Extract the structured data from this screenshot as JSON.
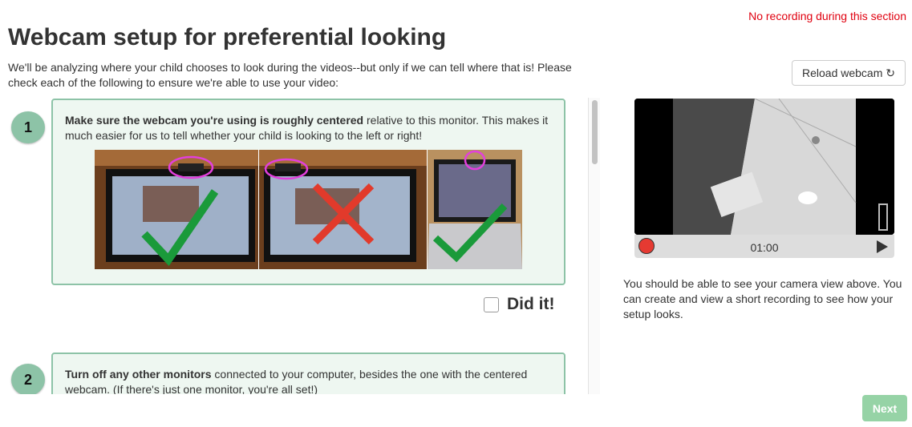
{
  "notice": "No recording during this section",
  "title": "Webcam setup for preferential looking",
  "intro": "We'll be analyzing where your child chooses to look during the videos--but only if we can tell where that is! Please check each of the following to ensure we're able to use your video:",
  "reload_label": "Reload webcam",
  "steps": [
    {
      "number": "1",
      "bold": "Make sure the webcam you're using is roughly centered",
      "text": " relative to this monitor. This makes it much easier for us to tell whether your child is looking to the left or right!",
      "done_label": "Did it!"
    },
    {
      "number": "2",
      "bold": "Turn off any other monitors",
      "text": " connected to your computer, besides the one with the centered webcam. (If there's just one monitor, you're all set!)"
    }
  ],
  "video": {
    "time": "01:00"
  },
  "side_text": "You should be able to see your camera view above. You can create and view a short recording to see how your setup looks.",
  "next_label": "Next",
  "colors": {
    "accent": "#8dc3a7",
    "card_bg": "#eef7f1",
    "notice": "#e0000f",
    "record": "#e53a32",
    "next": "#96d3a6",
    "check": "#1a9a3a",
    "cross": "#e23a2b",
    "circle": "#e23fdc"
  },
  "icons": [
    "refresh-icon",
    "checkmark-icon",
    "cross-icon",
    "record-icon",
    "play-icon",
    "checkbox-icon"
  ]
}
